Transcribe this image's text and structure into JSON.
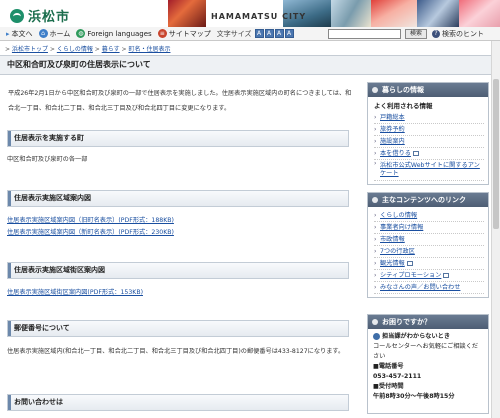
{
  "header": {
    "logo_text": "浜松市",
    "city_name": "HAMAMATSU CITY"
  },
  "util": {
    "text_content": "本文へ",
    "home": "ホーム",
    "foreign": "Foreign languages",
    "sitemap": "サイトマップ",
    "font_size_label": "文字サイズ",
    "font_sizes": [
      "A",
      "A",
      "A",
      "A"
    ],
    "search_placeholder": "",
    "search_button": "検索",
    "detail_search": "検索のヒント"
  },
  "breadcrumb": {
    "items": [
      "浜松市トップ",
      "くらしの情報",
      "暮らす",
      "町名・住居表示"
    ],
    "separator": " > "
  },
  "page_title": "中区和合町及び泉町の住居表示について",
  "main": {
    "intro": "平成26年2月1日から中区和合町及び泉町の一部で住居表示を実施しました。住居表示実施区域内の町名につきましては、和合北一丁目、和合北二丁目、和合北三丁目及び和合北四丁目に変更になります。",
    "sections": [
      {
        "heading": "住居表示を実施する町",
        "text": "中区和合町及び泉町の各一部"
      },
      {
        "heading": "住居表示実施区域案内図",
        "links": [
          "住居表示実施区域案内図（旧町名表示）(PDF形式：188KB)",
          "住居表示実施区域案内図（新町名表示）(PDF形式：230KB)"
        ]
      },
      {
        "heading": "住居表示実施区域街区案内図",
        "links": [
          "住居表示実施区域街区案内図(PDF形式：153KB)"
        ]
      },
      {
        "heading": "郵便番号について",
        "text": "住居表示実施区域内(和合北一丁目、和合北二丁目、和合北三丁目及び和合北四丁目)の郵便番号は433-8127になります。"
      },
      {
        "heading": "お問い合わせは"
      }
    ]
  },
  "sidebar": {
    "living": {
      "heading": "暮らしの情報",
      "sub": "よく利用される情報",
      "items": [
        "戸籍総本",
        "旅券予約",
        "施設案内",
        "本を借りる",
        "浜松市公式Webサイトに関するアンケート"
      ]
    },
    "contents": {
      "heading": "主なコンテンツへのリンク",
      "items": [
        "くらしの情報",
        "事業者向け情報",
        "市政情報",
        "7つの行政区",
        "観光情報",
        "シティプロモーション",
        "みなさんの声／お問い合わせ"
      ]
    },
    "help": {
      "heading": "お困りですか？",
      "question": "担当課がわからないとき",
      "line1": "コールセンターへお気軽にご相談ください",
      "phone_label": "■電話番号",
      "phone": "053-457-2111",
      "hours_label": "■受付時間",
      "hours": "午前8時30分～午後8時15分"
    }
  }
}
